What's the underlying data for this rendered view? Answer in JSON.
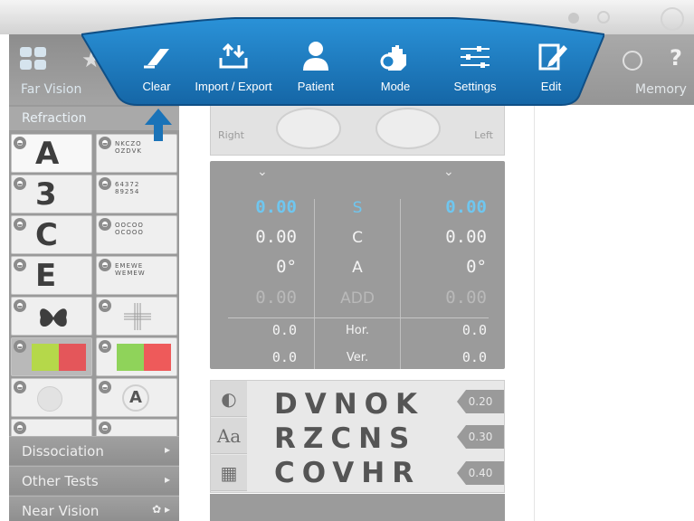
{
  "colors": {
    "toolbar_blue": "#1f82c9",
    "toolbar_blue_dark": "#1566a6",
    "sphere_value": "#6fc6ef",
    "panel_grey": "#9b9b9b"
  },
  "toolbar": {
    "items": [
      {
        "label": "Clear",
        "icon": "eraser-icon"
      },
      {
        "label": "Import / Export",
        "icon": "import-export-icon"
      },
      {
        "label": "Patient",
        "icon": "patient-icon"
      },
      {
        "label": "Mode",
        "icon": "mode-hand-gear-icon"
      },
      {
        "label": "Settings",
        "icon": "sliders-icon"
      },
      {
        "label": "Edit",
        "icon": "edit-icon"
      }
    ]
  },
  "sidebar": {
    "tab_label": "Far Vision",
    "section_label": "Refraction",
    "tests": [
      {
        "glyph": "A"
      },
      {
        "glyph": "NKCZO OZDVK"
      },
      {
        "glyph": "3"
      },
      {
        "glyph": "64372 89254"
      },
      {
        "glyph": "C"
      },
      {
        "glyph": "OOCOO OCOOO"
      },
      {
        "glyph": "E"
      },
      {
        "glyph": "EMEWE WEMEW"
      },
      {
        "glyph": "butterfly"
      },
      {
        "glyph": "cross"
      },
      {
        "glyph": "red-green"
      },
      {
        "glyph": "red-green-circles"
      },
      {
        "glyph": "dots"
      },
      {
        "glyph": "A"
      },
      {
        "glyph": "arc"
      },
      {
        "glyph": ""
      }
    ],
    "menu": [
      {
        "label": "Dissociation"
      },
      {
        "label": "Other Tests"
      },
      {
        "label": "Near Vision"
      }
    ]
  },
  "memory": {
    "label": "Memory"
  },
  "eyes": {
    "right_label": "Right",
    "left_label": "Left"
  },
  "refraction": {
    "rows": [
      {
        "key": "sph",
        "label": "S",
        "right": "0.00",
        "left": "0.00"
      },
      {
        "key": "cyl",
        "label": "C",
        "right": "0.00",
        "left": "0.00"
      },
      {
        "key": "axis",
        "label": "A",
        "right": "0°",
        "left": "0°"
      },
      {
        "key": "add",
        "label": "ADD",
        "right": "0.00",
        "left": "0.00"
      },
      {
        "key": "hor",
        "label": "Hor.",
        "right": "0.0",
        "left": "0.0"
      },
      {
        "key": "ver",
        "label": "Ver.",
        "right": "0.0",
        "left": "0.0"
      }
    ]
  },
  "optotype": {
    "lines": [
      {
        "letters": "DVNOK",
        "acuity": "0.20"
      },
      {
        "letters": "RZCNS",
        "acuity": "0.30"
      },
      {
        "letters": "COVHR",
        "acuity": "0.40"
      }
    ],
    "side_buttons": [
      "contrast-icon",
      "font-size-icon",
      "grid-icon"
    ]
  }
}
